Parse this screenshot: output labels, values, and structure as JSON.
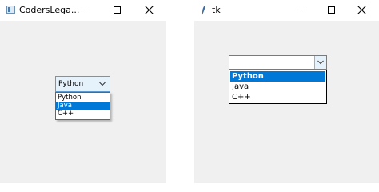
{
  "left_window": {
    "title": "CodersLega...",
    "combobox": {
      "value": "Python",
      "options": [
        "Python",
        "Java",
        "C++"
      ],
      "highlighted": "Java"
    }
  },
  "right_window": {
    "title": "tk",
    "combobox": {
      "value": "",
      "options": [
        "Python",
        "Java",
        "C++"
      ],
      "highlighted": "Python"
    }
  },
  "colors": {
    "selection": "#0078d7",
    "window_bg": "#f0f0f0",
    "focus_border": "#5a9bd5"
  }
}
